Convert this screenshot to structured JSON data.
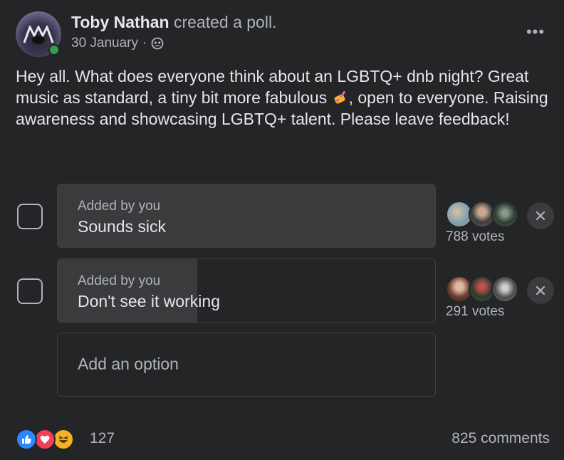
{
  "post": {
    "author": "Toby Nathan",
    "action": "created a poll.",
    "date": "30 January",
    "separator": "·",
    "audience_icon": "friends-icon",
    "more_icon": "more-options-icon",
    "more_label": "•••",
    "text_part1": "Hey all. What does everyone think about an LGBTQ+ dnb night? Great music as standard, a tiny bit more fabulous ",
    "text_emoji": "nail-polish-emoji",
    "text_part2": ", open to everyone. Raising awareness and showcasing LGBTQ+ talent. Please leave feedback!"
  },
  "poll": {
    "options": [
      {
        "added_by": "Added by you",
        "label": "Sounds sick",
        "votes": "788 votes",
        "vote_share": 1.0,
        "checked": false
      },
      {
        "added_by": "Added by you",
        "label": "Don't see it working",
        "votes": "291 votes",
        "vote_share": 0.369,
        "checked": false
      }
    ],
    "add_option_label": "Add an option"
  },
  "footer": {
    "reactions": [
      "like",
      "love",
      "haha"
    ],
    "reaction_count": "127",
    "comments": "825 comments"
  },
  "colors": {
    "background": "#242526",
    "option_fill": "#3a3b3c",
    "like": "#2d88ff",
    "love": "#f33e58",
    "haha": "#f7b125",
    "online": "#31a24c"
  }
}
